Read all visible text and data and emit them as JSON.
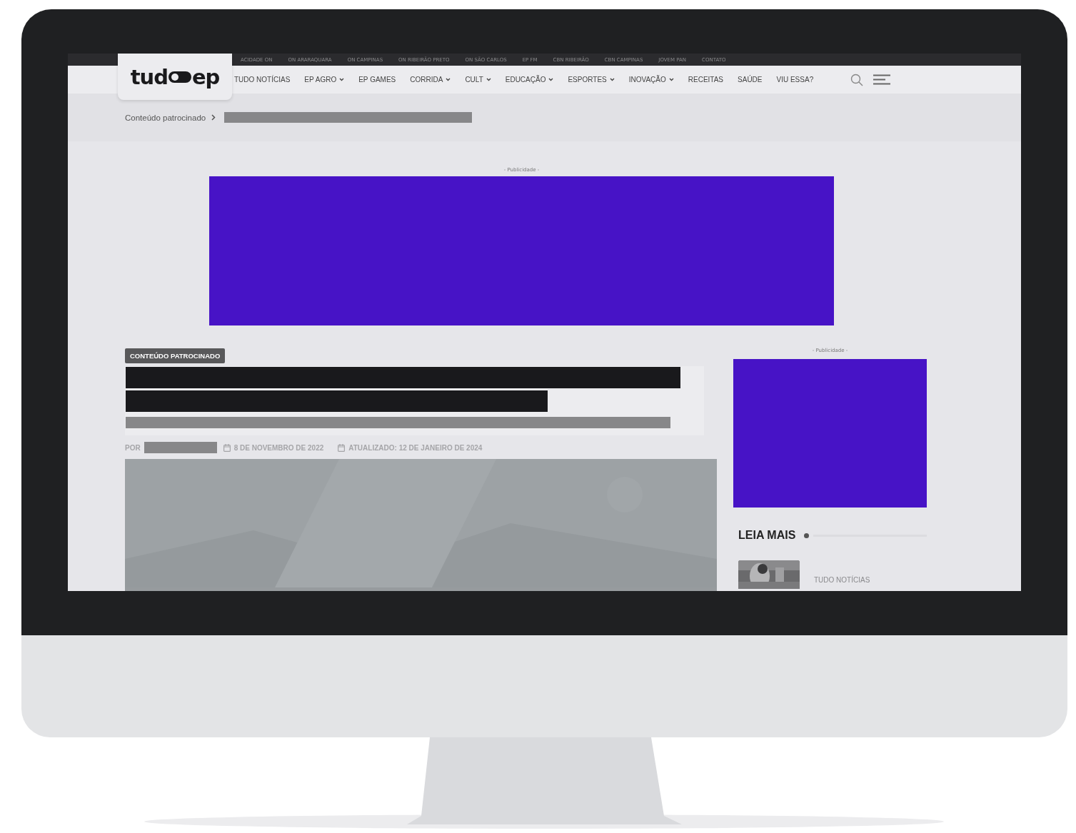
{
  "top_links": [
    "ACIDADE ON",
    "ON ARARAQUARA",
    "ON CAMPINAS",
    "ON RIBEIRÃO PRETO",
    "ON SÃO CARLOS",
    "EP FM",
    "CBN RIBEIRÃO",
    "CBN CAMPINAS",
    "JOVEM PAN",
    "CONTATO"
  ],
  "logo": {
    "before": "tud",
    "after": "ep"
  },
  "nav": [
    {
      "label": "TUDO NOTÍCIAS",
      "dropdown": false
    },
    {
      "label": "EP AGRO",
      "dropdown": true
    },
    {
      "label": "EP GAMES",
      "dropdown": false
    },
    {
      "label": "CORRIDA",
      "dropdown": true
    },
    {
      "label": "CULT",
      "dropdown": true
    },
    {
      "label": "EDUCAÇÃO",
      "dropdown": true
    },
    {
      "label": "ESPORTES",
      "dropdown": true
    },
    {
      "label": "INOVAÇÃO",
      "dropdown": true
    },
    {
      "label": "RECEITAS",
      "dropdown": false
    },
    {
      "label": "SAÚDE",
      "dropdown": false
    },
    {
      "label": "VIU ESSA?",
      "dropdown": false
    }
  ],
  "breadcrumb": [
    "Conteúdo patrocinado"
  ],
  "top_ad": {
    "label": "- Publicidade -"
  },
  "article": {
    "badge": "CONTEÚDO PATROCINADO",
    "by": "POR",
    "date": "8 DE NOVEMBRO DE 2022",
    "updated": "ATUALIZADO: 12 DE JANEIRO DE 2024"
  },
  "sidebar": {
    "ad_label": "- Publicidade -",
    "heading": "LEIA MAIS",
    "related": [
      {
        "category": "TUDO NOTÍCIAS"
      }
    ]
  }
}
